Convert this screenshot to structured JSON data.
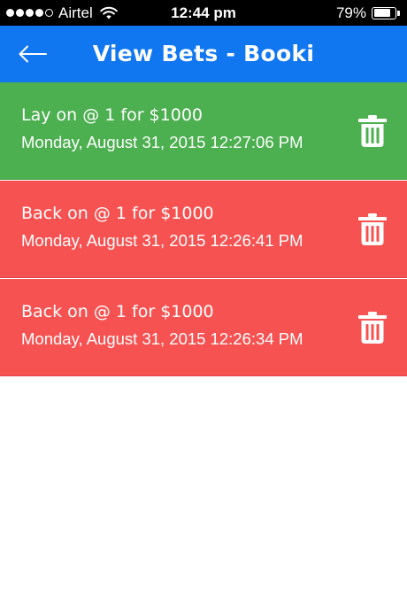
{
  "status_bar": {
    "carrier": "Airtel",
    "time": "12:44 pm",
    "battery": "79%",
    "battery_level": 0.79,
    "signal_bars_filled": 4,
    "signal_bars_total": 5
  },
  "app_bar": {
    "title": "View Bets - Booki",
    "back_icon": "arrow-left-icon"
  },
  "bets": [
    {
      "title": "Lay on @ 1 for $1000",
      "timestamp": "Monday, August 31, 2015 12:27:06 PM",
      "type": "lay",
      "color": "#4caf50"
    },
    {
      "title": "Back on @ 1 for $1000",
      "timestamp": "Monday, August 31, 2015 12:26:41 PM",
      "type": "back",
      "color": "#f75252"
    },
    {
      "title": "Back on @ 1 for $1000",
      "timestamp": "Monday, August 31, 2015 12:26:34 PM",
      "type": "back",
      "color": "#f75252"
    }
  ],
  "icons": {
    "delete": "trash-icon",
    "wifi": "wifi-icon",
    "battery": "battery-icon"
  },
  "colors": {
    "app_bar": "#1177f0",
    "status_bar": "#000000",
    "lay": "#4caf50",
    "back": "#f75252"
  }
}
